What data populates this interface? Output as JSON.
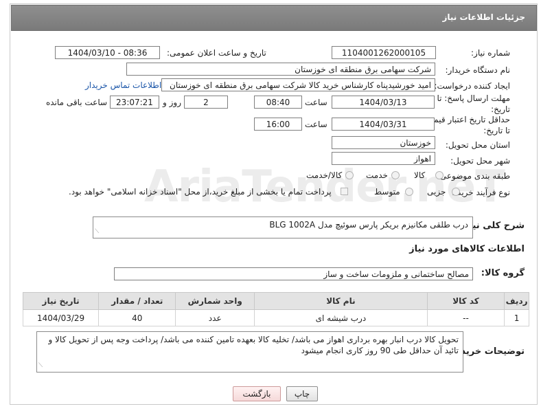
{
  "header": {
    "title": "جزئیات اطلاعات نیاز"
  },
  "labels": {
    "need_number": "شماره نیاز:",
    "announce_datetime": "تاریخ و ساعت اعلان عمومی:",
    "buyer_org": "نام دستگاه خریدار:",
    "requester": "ایجاد کننده درخواست:",
    "reply_deadline": "مهلت ارسال پاسخ: تا تاریخ:",
    "price_validity": "حداقل تاریخ اعتبار قیمت: تا تاریخ:",
    "time": "ساعت",
    "day_and": "روز و",
    "remaining": "ساعت باقی مانده",
    "province": "استان محل تحویل:",
    "city": "شهر محل تحویل:",
    "category": "طبقه بندی موضوعی:",
    "process_type": "نوع فرآیند خرید :",
    "general_desc": "شرح کلی نیاز:",
    "goods_info": "اطلاعات کالاهای مورد نیاز",
    "goods_group": "گروه کالا:",
    "buyer_notes": "توضیحات خریدار:"
  },
  "fields": {
    "need_number": "1104001262000105",
    "announce_datetime": "1404/03/10 - 08:36",
    "buyer_org": "شرکت سهامی برق منطقه ای خوزستان",
    "requester": "امید خورشیدپناه کارشناس خرید کالا شرکت سهامی برق منطقه ای خوزستان",
    "buyer_contact_link": "اطلاعات تماس خریدار",
    "reply_date": "1404/03/13",
    "reply_time": "08:40",
    "reply_days": "2",
    "reply_remaining": "23:07:21",
    "validity_date": "1404/03/31",
    "validity_time": "16:00",
    "province": "خوزستان",
    "city": "اهواز",
    "general_desc": "درب طلقی مکانیزم بریکر پارس سوئیچ مدل BLG 1002A",
    "goods_group": "مصالح ساختمانی و ملزومات ساخت و ساز",
    "buyer_notes": "تحویل کالا درب انبار بهره برداری اهواز می باشد/ تخلیه کالا بعهده تامین کننده می باشد/ پرداخت وجه پس از تحویل کالا و تائید آن حداقل طی 90 روز کاری انجام میشود"
  },
  "category_options": {
    "goods": "کالا",
    "service": "خدمت",
    "goods_service": "کالا/خدمت"
  },
  "process_options": {
    "partial": "جزیی",
    "medium": "متوسط",
    "treasury_note": "پرداخت تمام یا بخشی از مبلغ خرید،از محل \"اسناد خزانه اسلامی\" خواهد بود."
  },
  "table": {
    "headers": {
      "row": "ردیف",
      "code": "کد کالا",
      "name": "نام کالا",
      "unit": "واحد شمارش",
      "qty": "تعداد / مقدار",
      "date": "تاریخ نیاز"
    },
    "rows": [
      {
        "row": "1",
        "code": "--",
        "name": "درب شیشه ای",
        "unit": "عدد",
        "qty": "40",
        "date": "1404/03/29"
      }
    ]
  },
  "buttons": {
    "print": "چاپ",
    "back": "بازگشت"
  },
  "watermark": "AriaTender.neT",
  "colors": {
    "header_bg": "#858585",
    "link": "#1a55a8",
    "back_button": "#f5d9d9"
  }
}
